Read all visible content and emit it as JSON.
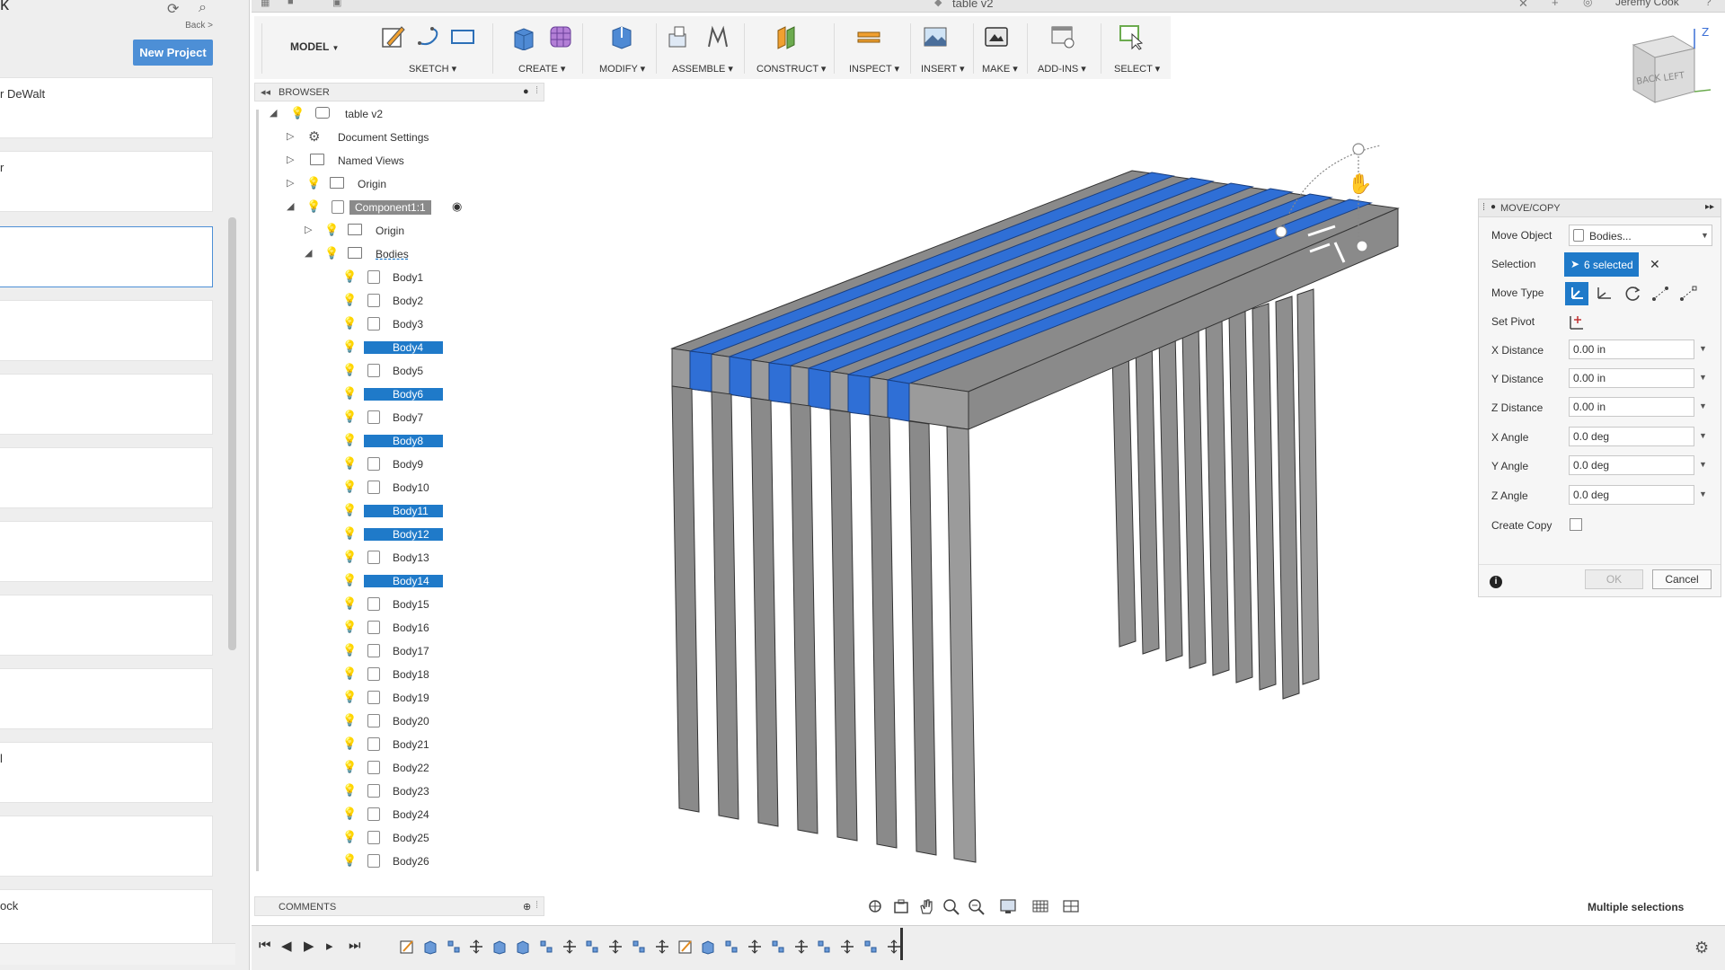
{
  "data_panel": {
    "title": "k",
    "back_label": "Back >",
    "new_project_label": "New Project",
    "items": [
      {
        "label": "r DeWalt"
      },
      {
        "label": "r"
      },
      {
        "label": ""
      },
      {
        "label": ""
      },
      {
        "label": ""
      },
      {
        "label": ""
      },
      {
        "label": ""
      },
      {
        "label": ""
      },
      {
        "label": ""
      },
      {
        "label": "l"
      },
      {
        "label": ""
      },
      {
        "label": "ock"
      }
    ]
  },
  "topbar": {
    "document_tab": "table v2",
    "user_name": "Jeremy Cook"
  },
  "toolbar": {
    "workspace": "MODEL",
    "groups": [
      {
        "label": "SKETCH"
      },
      {
        "label": "CREATE"
      },
      {
        "label": "MODIFY"
      },
      {
        "label": "ASSEMBLE"
      },
      {
        "label": "CONSTRUCT"
      },
      {
        "label": "INSPECT"
      },
      {
        "label": "INSERT"
      },
      {
        "label": "MAKE"
      },
      {
        "label": "ADD-INS"
      },
      {
        "label": "SELECT"
      }
    ]
  },
  "browser": {
    "title": "BROWSER",
    "root": "table v2",
    "items": [
      {
        "label": "Document Settings"
      },
      {
        "label": "Named Views"
      },
      {
        "label": "Origin"
      },
      {
        "label": "Component1:1"
      },
      {
        "label": "Origin"
      },
      {
        "label": "Bodies"
      }
    ],
    "bodies": [
      {
        "label": "Body1",
        "selected": false
      },
      {
        "label": "Body2",
        "selected": false
      },
      {
        "label": "Body3",
        "selected": false
      },
      {
        "label": "Body4",
        "selected": true
      },
      {
        "label": "Body5",
        "selected": false
      },
      {
        "label": "Body6",
        "selected": true
      },
      {
        "label": "Body7",
        "selected": false
      },
      {
        "label": "Body8",
        "selected": true
      },
      {
        "label": "Body9",
        "selected": false
      },
      {
        "label": "Body10",
        "selected": false
      },
      {
        "label": "Body11",
        "selected": true
      },
      {
        "label": "Body12",
        "selected": true
      },
      {
        "label": "Body13",
        "selected": false
      },
      {
        "label": "Body14",
        "selected": true
      },
      {
        "label": "Body15",
        "selected": false
      },
      {
        "label": "Body16",
        "selected": false
      },
      {
        "label": "Body17",
        "selected": false
      },
      {
        "label": "Body18",
        "selected": false
      },
      {
        "label": "Body19",
        "selected": false
      },
      {
        "label": "Body20",
        "selected": false
      },
      {
        "label": "Body21",
        "selected": false
      },
      {
        "label": "Body22",
        "selected": false
      },
      {
        "label": "Body23",
        "selected": false
      },
      {
        "label": "Body24",
        "selected": false
      },
      {
        "label": "Body25",
        "selected": false
      },
      {
        "label": "Body26",
        "selected": false
      }
    ]
  },
  "comments": {
    "title": "COMMENTS"
  },
  "move_copy": {
    "title": "MOVE/COPY",
    "move_object_label": "Move Object",
    "move_object_value": "Bodies...",
    "selection_label": "Selection",
    "selection_value": "6 selected",
    "move_type_label": "Move Type",
    "set_pivot_label": "Set Pivot",
    "fields": [
      {
        "label": "X Distance",
        "value": "0.00 in"
      },
      {
        "label": "Y Distance",
        "value": "0.00 in"
      },
      {
        "label": "Z Distance",
        "value": "0.00 in"
      },
      {
        "label": "X Angle",
        "value": "0.0 deg"
      },
      {
        "label": "Y Angle",
        "value": "0.0 deg"
      },
      {
        "label": "Z Angle",
        "value": "0.0 deg"
      }
    ],
    "create_copy_label": "Create Copy",
    "ok_label": "OK",
    "cancel_label": "Cancel"
  },
  "status": {
    "text": "Multiple selections"
  },
  "viewcube": {
    "back": "BACK",
    "left": "LEFT",
    "z_axis": "Z"
  },
  "colors": {
    "selected_highlight": "#1f7ac9",
    "body_top": "#2f6fd6",
    "body_side": "#7e7e7e",
    "body_front": "#9a9a9a",
    "accent_button": "#4d8fd6"
  }
}
